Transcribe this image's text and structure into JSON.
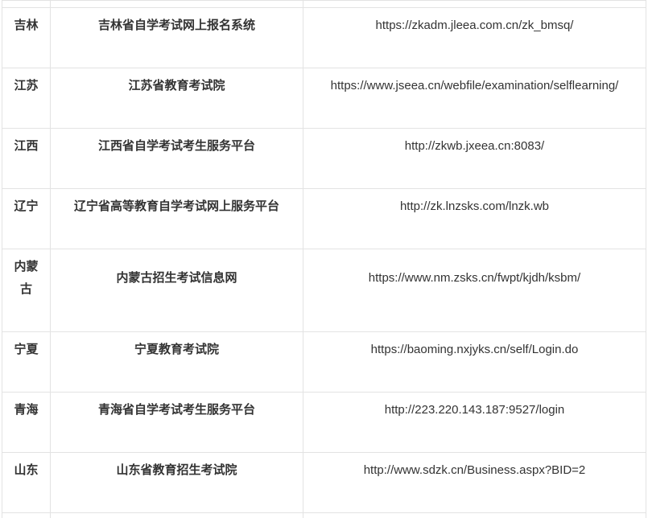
{
  "table": {
    "rows": [
      {
        "province": "吉林",
        "name": "吉林省自学考试网上报名系统",
        "url": "https://zkadm.jleea.com.cn/zk_bmsq/"
      },
      {
        "province": "江苏",
        "name": "江苏省教育考试院",
        "url": "https://www.jseea.cn/webfile/examination/selflearning/"
      },
      {
        "province": "江西",
        "name": "江西省自学考试考生服务平台",
        "url": "http://zkwb.jxeea.cn:8083/"
      },
      {
        "province": "辽宁",
        "name": "辽宁省高等教育自学考试网上服务平台",
        "url": "http://zk.lnzsks.com/lnzk.wb"
      },
      {
        "province": "内蒙古",
        "name": "内蒙古招生考试信息网",
        "url": "https://www.nm.zsks.cn/fwpt/kjdh/ksbm/"
      },
      {
        "province": "宁夏",
        "name": "宁夏教育考试院",
        "url": "https://baoming.nxjyks.cn/self/Login.do"
      },
      {
        "province": "青海",
        "name": "青海省自学考试考生服务平台",
        "url": "http://223.220.143.187:9527/login"
      },
      {
        "province": "山东",
        "name": "山东省教育招生考试院",
        "url": "http://www.sdzk.cn/Business.aspx?BID=2"
      }
    ]
  },
  "colors": {
    "text": "#333333",
    "border": "#e3e3e3",
    "background": "#ffffff"
  }
}
